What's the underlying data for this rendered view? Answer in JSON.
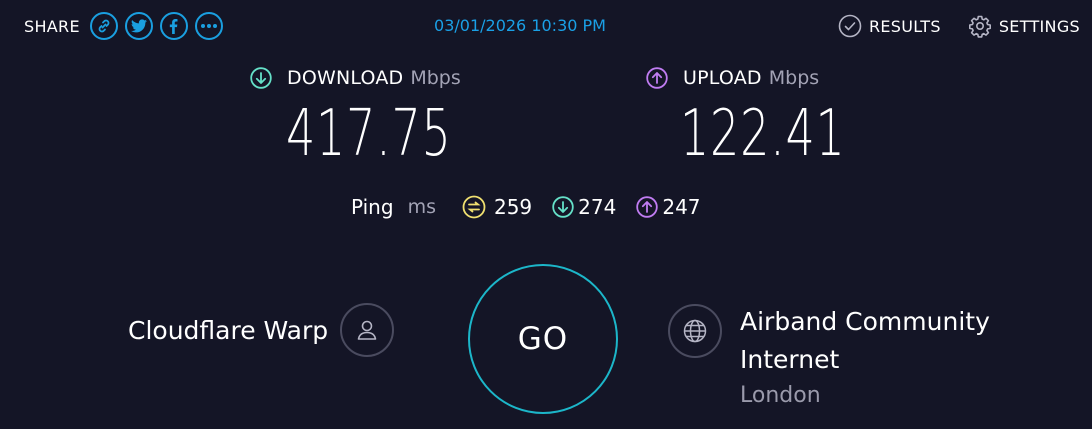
{
  "share": {
    "label": "SHARE",
    "buttons": [
      "link-icon",
      "twitter-icon",
      "facebook-icon",
      "more-icon"
    ]
  },
  "timestamp": "03/01/2026 10:30 PM",
  "nav": {
    "results_label": "RESULTS",
    "settings_label": "SETTINGS"
  },
  "download": {
    "label": "DOWNLOAD",
    "unit": "Mbps",
    "value": "417.75",
    "color": "#65e0c8"
  },
  "upload": {
    "label": "UPLOAD",
    "unit": "Mbps",
    "value": "122.41",
    "color": "#c07cf2"
  },
  "ping": {
    "label": "Ping",
    "unit": "ms",
    "idle": "259",
    "download": "274",
    "upload": "247",
    "idle_color": "#f0e070"
  },
  "server": {
    "name": "Cloudflare Warp"
  },
  "go_label": "GO",
  "isp": {
    "name": "Airband Community Internet",
    "location": "London"
  },
  "colors": {
    "background": "#141526",
    "accent": "#1a9fe0",
    "go_ring": "#1cb6c9"
  }
}
